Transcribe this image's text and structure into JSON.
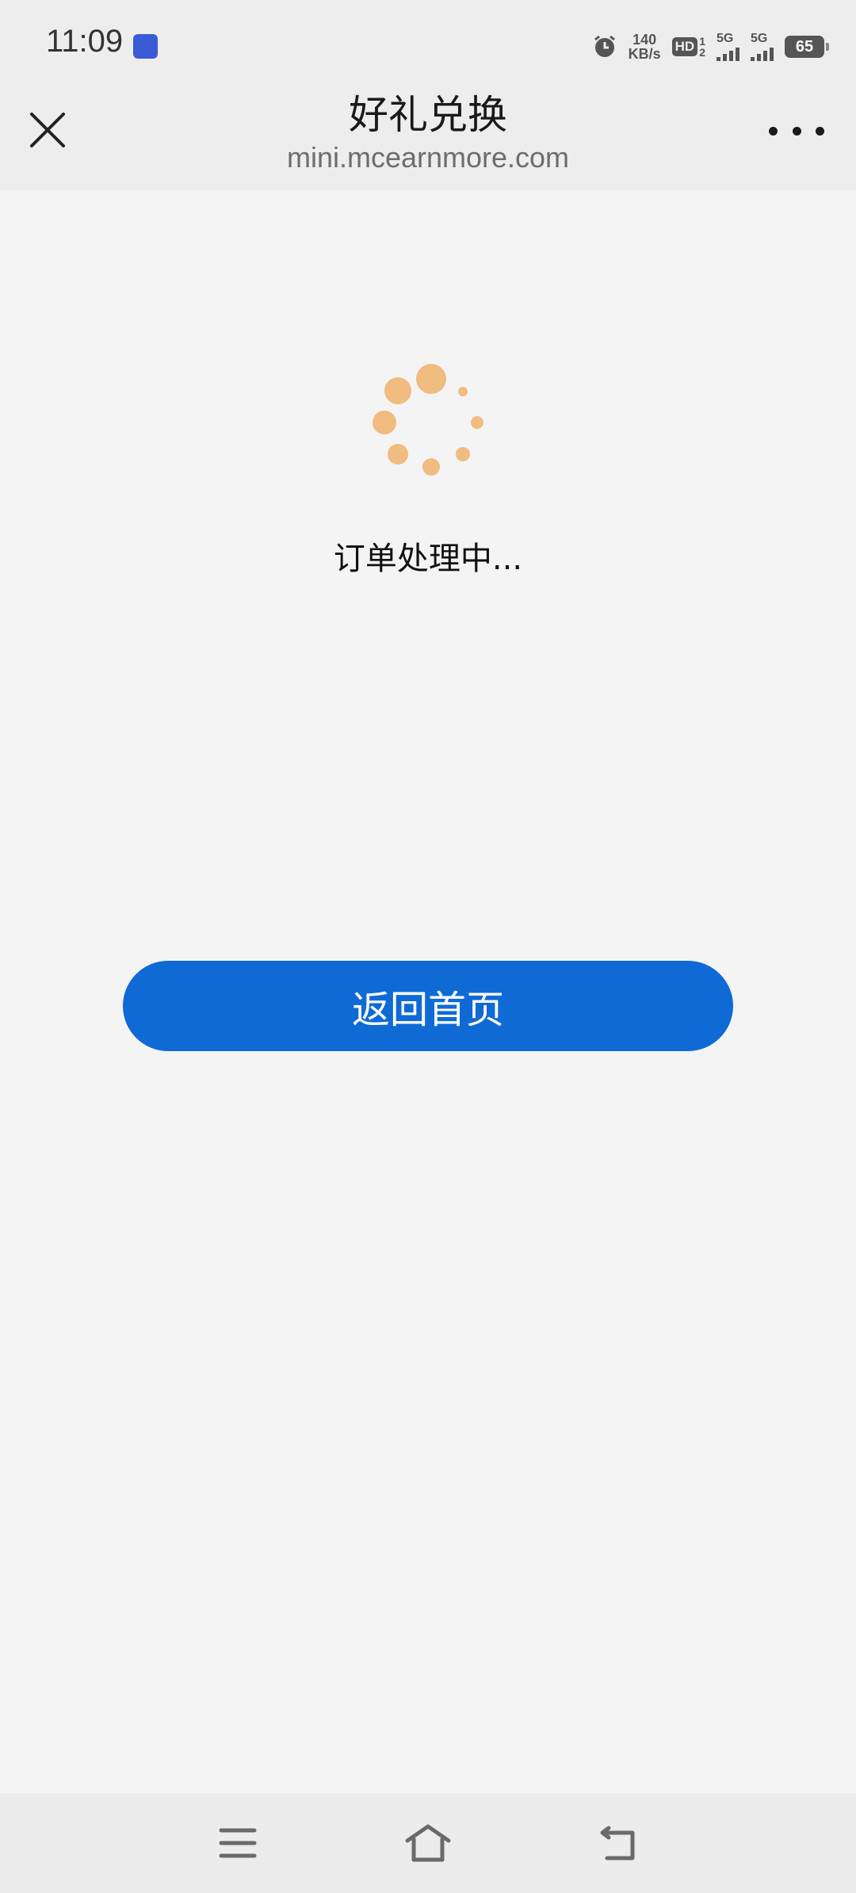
{
  "status_bar": {
    "time": "11:09",
    "net_speed_value": "140",
    "net_speed_unit": "KB/s",
    "hd_label": "HD",
    "sim1_label": "1",
    "sim2_label": "2",
    "net1_label": "5G",
    "net2_label": "5G",
    "battery_level": "65"
  },
  "nav": {
    "title": "好礼兑换",
    "subtitle": "mini.mcearnmore.com"
  },
  "main": {
    "loading_text": "订单处理中...",
    "home_button_label": "返回首页"
  },
  "colors": {
    "accent": "#0f6ad6",
    "spinner": "#f0bc80"
  },
  "icons": {
    "close": "close-icon",
    "more": "more-icon",
    "menu": "menu-icon",
    "home": "home-icon",
    "back": "back-icon",
    "alarm": "alarm-icon"
  }
}
